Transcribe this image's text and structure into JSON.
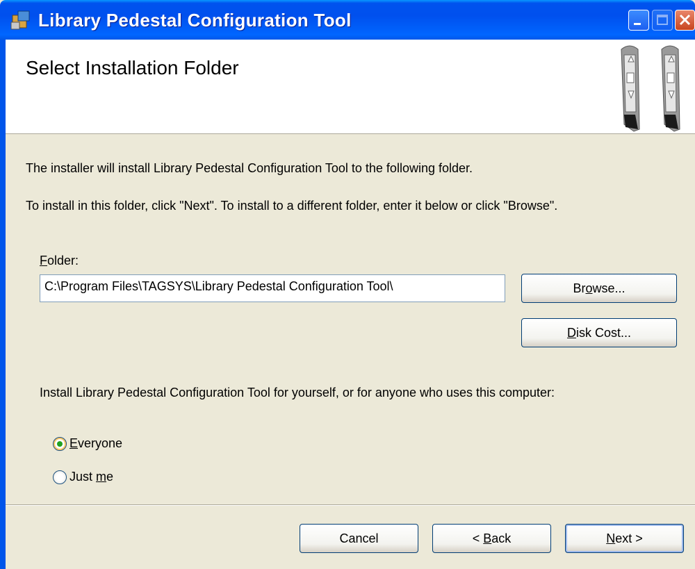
{
  "window": {
    "title": "Library Pedestal Configuration Tool"
  },
  "banner": {
    "title": "Select Installation Folder"
  },
  "body": {
    "line1": "The installer will install Library Pedestal Configuration Tool to the following folder.",
    "line2": "To install in this folder, click \"Next\". To install to a different folder, enter it below or click \"Browse\"."
  },
  "folder": {
    "label_first": "F",
    "label_rest": "older:",
    "value": "C:\\Program Files\\TAGSYS\\Library Pedestal Configuration Tool\\"
  },
  "buttons": {
    "browse_pre": "Br",
    "browse_u": "o",
    "browse_post": "wse...",
    "diskcost_u": "D",
    "diskcost_post": "isk Cost...",
    "cancel": "Cancel",
    "back_pre": "< ",
    "back_u": "B",
    "back_post": "ack",
    "next_u": "N",
    "next_post": "ext >"
  },
  "install_for": {
    "question": "Install Library Pedestal Configuration Tool for yourself, or for anyone who uses this computer:",
    "options": [
      {
        "u": "E",
        "rest": "veryone",
        "checked": true
      },
      {
        "pre": "Just ",
        "u": "m",
        "rest": "e",
        "checked": false
      }
    ]
  },
  "colors": {
    "titlebar": "#0054e3",
    "face": "#ece9d8",
    "radio_dot": "#21a121"
  }
}
